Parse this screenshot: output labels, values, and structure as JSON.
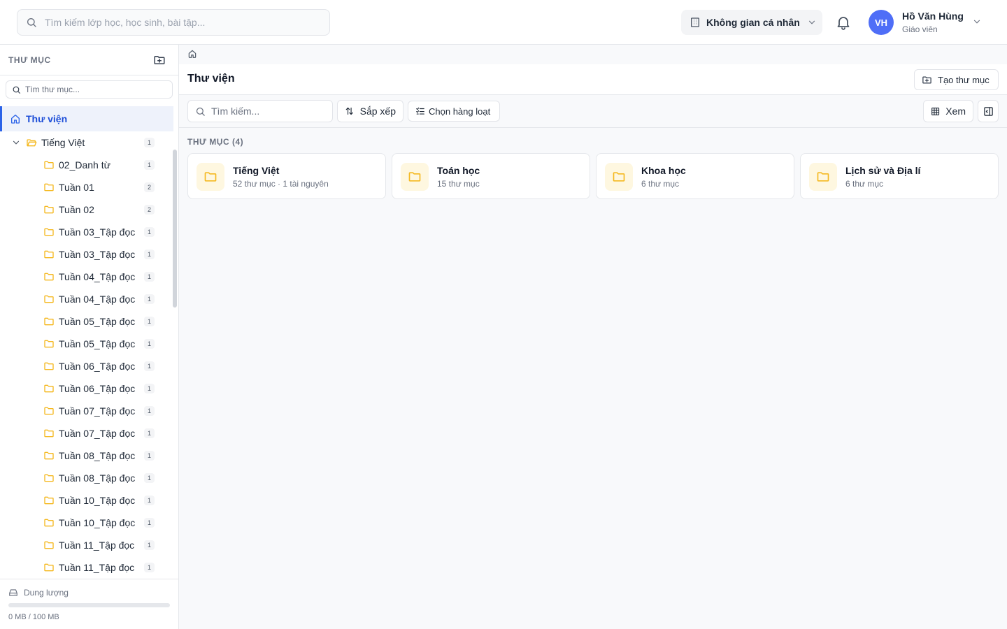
{
  "topbar": {
    "search_placeholder": "Tìm kiếm lớp học, học sinh, bài tập...",
    "workspace_label": "Không gian cá nhân",
    "user": {
      "initials": "VH",
      "name": "Hồ Văn Hùng",
      "role": "Giáo viên",
      "avatar_color": "#4f6ef7"
    }
  },
  "sidebar": {
    "title": "THƯ MỤC",
    "search_placeholder": "Tìm thư mục...",
    "root_label": "Thư viện",
    "parent": {
      "label": "Tiếng Việt",
      "count": "1"
    },
    "items": [
      {
        "label": "02_Danh từ",
        "count": "1"
      },
      {
        "label": "Tuần 01",
        "count": "2"
      },
      {
        "label": "Tuần 02",
        "count": "2"
      },
      {
        "label": "Tuần 03_Tập đọc",
        "count": "1"
      },
      {
        "label": "Tuần 03_Tập đọc",
        "count": "1"
      },
      {
        "label": "Tuần 04_Tập đọc",
        "count": "1"
      },
      {
        "label": "Tuần 04_Tập đọc",
        "count": "1"
      },
      {
        "label": "Tuần 05_Tập đọc",
        "count": "1"
      },
      {
        "label": "Tuần 05_Tập đọc",
        "count": "1"
      },
      {
        "label": "Tuần 06_Tập đọc",
        "count": "1"
      },
      {
        "label": "Tuần 06_Tập đọc",
        "count": "1"
      },
      {
        "label": "Tuần 07_Tập đọc",
        "count": "1"
      },
      {
        "label": "Tuần 07_Tập đọc",
        "count": "1"
      },
      {
        "label": "Tuần 08_Tập đọc",
        "count": "1"
      },
      {
        "label": "Tuần 08_Tập đọc",
        "count": "1"
      },
      {
        "label": "Tuần 10_Tập đọc",
        "count": "1"
      },
      {
        "label": "Tuần 10_Tập đọc",
        "count": "1"
      },
      {
        "label": "Tuần 11_Tập đọc",
        "count": "1"
      },
      {
        "label": "Tuần 11_Tập đọc",
        "count": "1"
      }
    ],
    "storage": {
      "label": "Dung lượng",
      "text": "0 MB / 100 MB",
      "used_fraction": 0
    }
  },
  "main": {
    "title": "Thư viện",
    "create_folder_label": "Tạo thư mục",
    "search_placeholder": "Tìm kiếm...",
    "sort_label": "Sắp xếp",
    "bulk_select_label": "Chọn hàng loạt",
    "view_label": "Xem",
    "section_label": "THƯ MỤC (4)",
    "folders": [
      {
        "name": "Tiếng Việt",
        "meta": "52 thư mục · 1 tài nguyên"
      },
      {
        "name": "Toán học",
        "meta": "15 thư mục"
      },
      {
        "name": "Khoa học",
        "meta": "6 thư mục"
      },
      {
        "name": "Lịch sử và Địa lí",
        "meta": "6 thư mục"
      }
    ]
  },
  "colors": {
    "accent": "#2c63e8",
    "folder": "#f5b921",
    "folder_bg": "#fef7e0"
  }
}
